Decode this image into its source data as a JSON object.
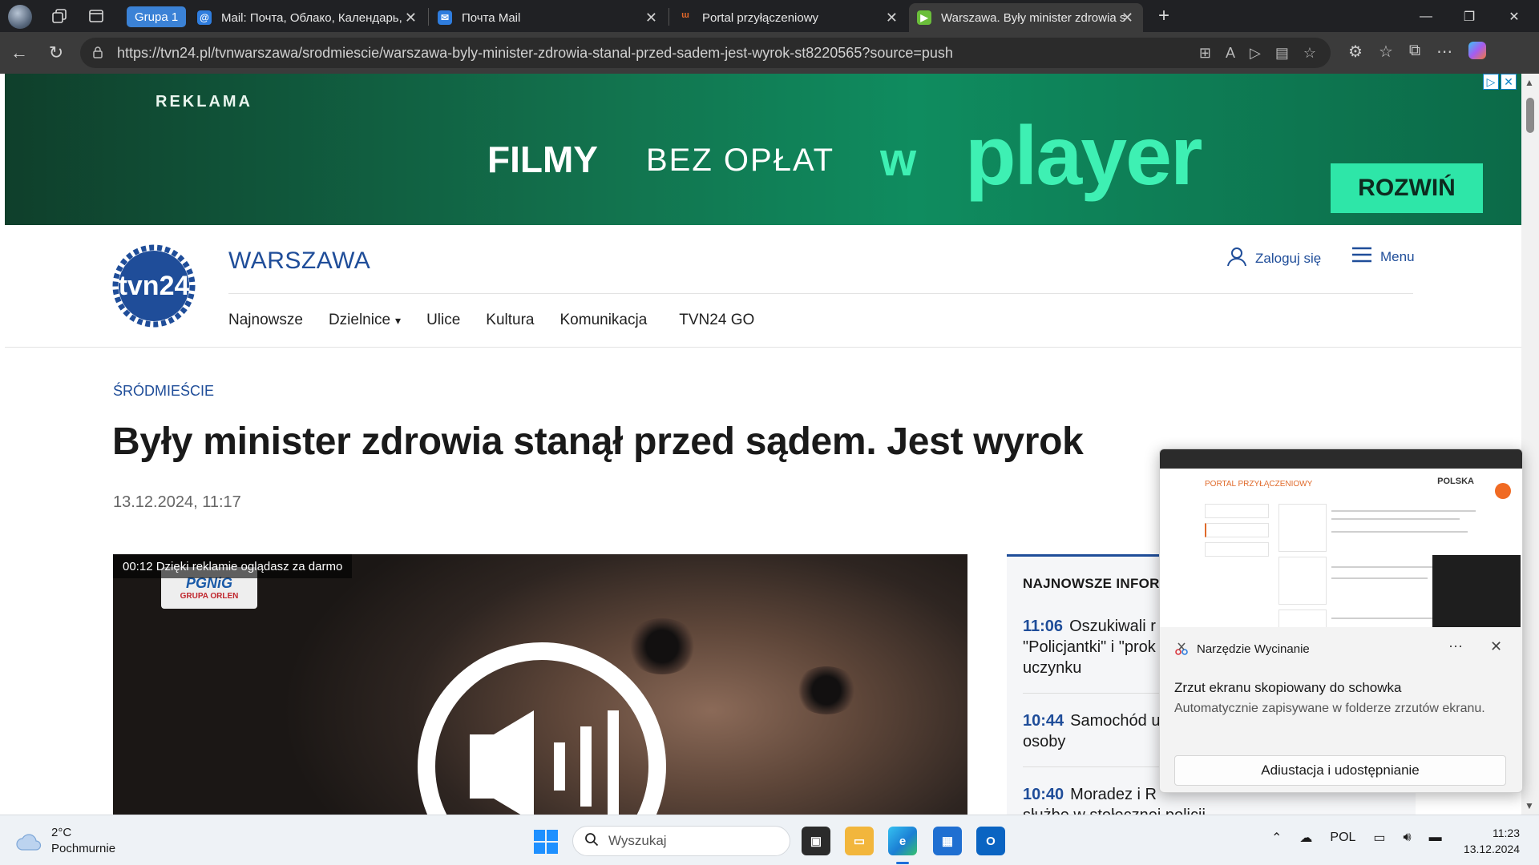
{
  "browser": {
    "group_chip": "Grupa 1",
    "tabs": [
      {
        "label": "Mail: Почта, Облако, Календарь,",
        "favicon": "at-icon",
        "color": "#2f7dde"
      },
      {
        "label": "Почта Mail",
        "favicon": "mail-icon",
        "color": "#2f7dde"
      },
      {
        "label": "Portal przyłączeniowy",
        "favicon": "flame-icon",
        "color": "#e0672a"
      },
      {
        "label": "Warszawa. Były minister zdrowia s",
        "favicon": "tvn-icon",
        "color": "#6bbf3b"
      }
    ],
    "url": "https://tvn24.pl/tvnwarszawa/srodmiescie/warszawa-byly-minister-zdrowia-stanal-przed-sadem-jest-wyrok-st8220565?source=push"
  },
  "ad": {
    "label": "REKLAMA",
    "word1": "FILMY",
    "word2": "BEZ OPŁAT",
    "word3": "w",
    "brand": "player",
    "cta": "ROZWIŃ"
  },
  "header": {
    "logo_text": "tvn24",
    "section": "WARSZAWA",
    "login": "Zaloguj się",
    "menu": "Menu",
    "nav": [
      "Najnowsze",
      "Dzielnice",
      "Ulice",
      "Kultura",
      "Komunikacja",
      "TVN24 GO"
    ]
  },
  "article": {
    "category": "ŚRÓDMIEŚCIE",
    "title": "Były minister zdrowia stanął przed sądem. Jest wyrok",
    "date": "13.12.2024, 11:17"
  },
  "video": {
    "badge": "00:12 Dzięki reklamie oglądasz za darmo",
    "sponsor_top": "PGNiG",
    "sponsor_bottom": "GRUPA ORLEN"
  },
  "news": {
    "title": "NAJNOWSZE INFORM",
    "items": [
      {
        "time": "11:06",
        "text": "Oszukiwali r"
      },
      {
        "time": "",
        "text": "\"Policjantki\" i \"prok"
      },
      {
        "time": "",
        "text": "uczynku"
      },
      {
        "time": "10:44",
        "text": "Samochód u"
      },
      {
        "time": "",
        "text": "osoby"
      },
      {
        "time": "10:40",
        "text": "Moradez i R"
      },
      {
        "time": "",
        "text": "służbe w stołecznej policji"
      }
    ]
  },
  "toast": {
    "thumb_header": "PORTAL PRZYŁĄCZENIOWY",
    "thumb_logo": "POLSKA",
    "app": "Narzędzie Wycinanie",
    "message": "Zrzut ekranu skopiowany do schowka",
    "sub": "Automatycznie zapisywane w folderze zrzutów ekranu.",
    "button": "Adiustacja i udostępnianie"
  },
  "taskbar": {
    "temp": "2°C",
    "weather": "Pochmurnie",
    "search_placeholder": "Wyszukaj",
    "lang": "POL",
    "time": "11:23",
    "date": "13.12.2024"
  }
}
